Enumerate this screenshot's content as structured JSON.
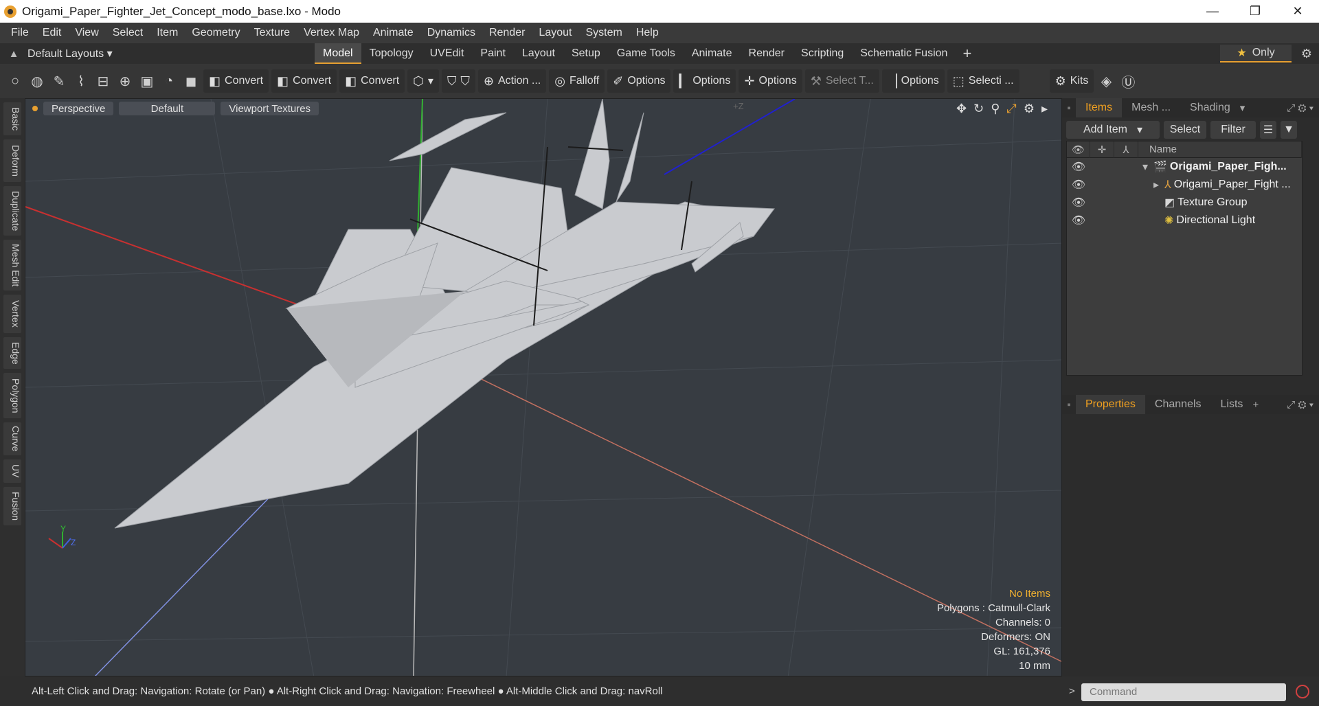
{
  "window": {
    "title": "Origami_Paper_Fighter_Jet_Concept_modo_base.lxo - Modo",
    "minimize": "—",
    "maximize": "❐",
    "close": "✕"
  },
  "menu": [
    "File",
    "Edit",
    "View",
    "Select",
    "Item",
    "Geometry",
    "Texture",
    "Vertex Map",
    "Animate",
    "Dynamics",
    "Render",
    "Layout",
    "System",
    "Help"
  ],
  "layouts": {
    "label": "Default Layouts ▾"
  },
  "tabs": [
    "Model",
    "Topology",
    "UVEdit",
    "Paint",
    "Layout",
    "Setup",
    "Game Tools",
    "Animate",
    "Render",
    "Scripting",
    "Schematic Fusion"
  ],
  "active_tab": "Model",
  "only_label": "Only",
  "toolbar": {
    "convert1": "Convert",
    "convert2": "Convert",
    "convert3": "Convert",
    "action": "Action ...",
    "falloff": "Falloff",
    "options1": "Options",
    "options2": "Options",
    "options3": "Options",
    "select_t": "Select T...",
    "options4": "Options",
    "selecti": "Selecti ...",
    "kits": "Kits"
  },
  "left_rail": [
    "Basic",
    "Deform",
    "Duplicate",
    "Mesh Edit",
    "Vertex",
    "Edge",
    "Polygon",
    "Curve",
    "UV",
    "Fusion"
  ],
  "viewport": {
    "view": "Perspective",
    "shading": "Default",
    "textures": "Viewport Textures",
    "axis_label": "+Z",
    "info": {
      "no_items": "No Items",
      "polygons": "Polygons : Catmull-Clark",
      "channels": "Channels: 0",
      "deformers": "Deformers: ON",
      "gl": "GL: 161,376",
      "scale": "10 mm"
    }
  },
  "items_panel": {
    "tabs": [
      "Items",
      "Mesh ...",
      "Shading"
    ],
    "add_item": "Add Item",
    "select": "Select",
    "filter": "Filter",
    "name_header": "Name",
    "rows": [
      {
        "label": "Origami_Paper_Figh...",
        "icon": "scene-icon"
      },
      {
        "label": "Origami_Paper_Fight ...",
        "icon": "mesh-icon"
      },
      {
        "label": "Texture Group",
        "icon": "texture-group-icon"
      },
      {
        "label": "Directional Light",
        "icon": "light-icon"
      }
    ]
  },
  "properties_panel": {
    "tabs": [
      "Properties",
      "Channels",
      "Lists"
    ]
  },
  "status": {
    "hint": "Alt-Left Click and Drag: Navigation: Rotate (or Pan) ● Alt-Right Click and Drag: Navigation: Freewheel ● Alt-Middle Click and Drag: navRoll",
    "command_placeholder": "Command"
  }
}
